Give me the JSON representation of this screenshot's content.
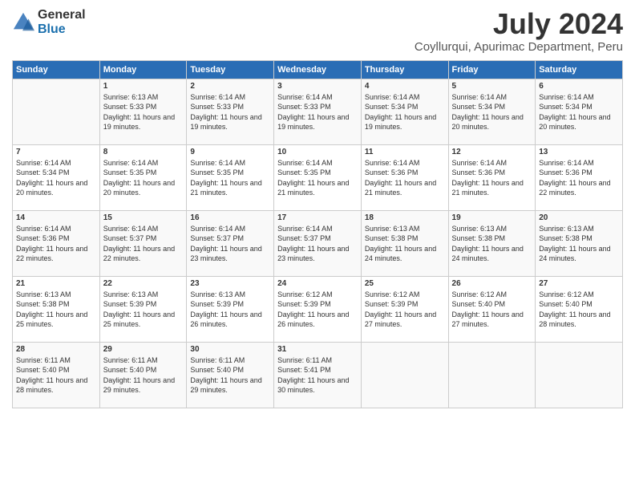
{
  "logo": {
    "general": "General",
    "blue": "Blue"
  },
  "header": {
    "month": "July 2024",
    "location": "Coyllurqui, Apurimac Department, Peru"
  },
  "days_of_week": [
    "Sunday",
    "Monday",
    "Tuesday",
    "Wednesday",
    "Thursday",
    "Friday",
    "Saturday"
  ],
  "weeks": [
    [
      {
        "day": "",
        "sunrise": "",
        "sunset": "",
        "daylight": ""
      },
      {
        "day": "1",
        "sunrise": "Sunrise: 6:13 AM",
        "sunset": "Sunset: 5:33 PM",
        "daylight": "Daylight: 11 hours and 19 minutes."
      },
      {
        "day": "2",
        "sunrise": "Sunrise: 6:14 AM",
        "sunset": "Sunset: 5:33 PM",
        "daylight": "Daylight: 11 hours and 19 minutes."
      },
      {
        "day": "3",
        "sunrise": "Sunrise: 6:14 AM",
        "sunset": "Sunset: 5:33 PM",
        "daylight": "Daylight: 11 hours and 19 minutes."
      },
      {
        "day": "4",
        "sunrise": "Sunrise: 6:14 AM",
        "sunset": "Sunset: 5:34 PM",
        "daylight": "Daylight: 11 hours and 19 minutes."
      },
      {
        "day": "5",
        "sunrise": "Sunrise: 6:14 AM",
        "sunset": "Sunset: 5:34 PM",
        "daylight": "Daylight: 11 hours and 20 minutes."
      },
      {
        "day": "6",
        "sunrise": "Sunrise: 6:14 AM",
        "sunset": "Sunset: 5:34 PM",
        "daylight": "Daylight: 11 hours and 20 minutes."
      }
    ],
    [
      {
        "day": "7",
        "sunrise": "Sunrise: 6:14 AM",
        "sunset": "Sunset: 5:34 PM",
        "daylight": "Daylight: 11 hours and 20 minutes."
      },
      {
        "day": "8",
        "sunrise": "Sunrise: 6:14 AM",
        "sunset": "Sunset: 5:35 PM",
        "daylight": "Daylight: 11 hours and 20 minutes."
      },
      {
        "day": "9",
        "sunrise": "Sunrise: 6:14 AM",
        "sunset": "Sunset: 5:35 PM",
        "daylight": "Daylight: 11 hours and 21 minutes."
      },
      {
        "day": "10",
        "sunrise": "Sunrise: 6:14 AM",
        "sunset": "Sunset: 5:35 PM",
        "daylight": "Daylight: 11 hours and 21 minutes."
      },
      {
        "day": "11",
        "sunrise": "Sunrise: 6:14 AM",
        "sunset": "Sunset: 5:36 PM",
        "daylight": "Daylight: 11 hours and 21 minutes."
      },
      {
        "day": "12",
        "sunrise": "Sunrise: 6:14 AM",
        "sunset": "Sunset: 5:36 PM",
        "daylight": "Daylight: 11 hours and 21 minutes."
      },
      {
        "day": "13",
        "sunrise": "Sunrise: 6:14 AM",
        "sunset": "Sunset: 5:36 PM",
        "daylight": "Daylight: 11 hours and 22 minutes."
      }
    ],
    [
      {
        "day": "14",
        "sunrise": "Sunrise: 6:14 AM",
        "sunset": "Sunset: 5:36 PM",
        "daylight": "Daylight: 11 hours and 22 minutes."
      },
      {
        "day": "15",
        "sunrise": "Sunrise: 6:14 AM",
        "sunset": "Sunset: 5:37 PM",
        "daylight": "Daylight: 11 hours and 22 minutes."
      },
      {
        "day": "16",
        "sunrise": "Sunrise: 6:14 AM",
        "sunset": "Sunset: 5:37 PM",
        "daylight": "Daylight: 11 hours and 23 minutes."
      },
      {
        "day": "17",
        "sunrise": "Sunrise: 6:14 AM",
        "sunset": "Sunset: 5:37 PM",
        "daylight": "Daylight: 11 hours and 23 minutes."
      },
      {
        "day": "18",
        "sunrise": "Sunrise: 6:13 AM",
        "sunset": "Sunset: 5:38 PM",
        "daylight": "Daylight: 11 hours and 24 minutes."
      },
      {
        "day": "19",
        "sunrise": "Sunrise: 6:13 AM",
        "sunset": "Sunset: 5:38 PM",
        "daylight": "Daylight: 11 hours and 24 minutes."
      },
      {
        "day": "20",
        "sunrise": "Sunrise: 6:13 AM",
        "sunset": "Sunset: 5:38 PM",
        "daylight": "Daylight: 11 hours and 24 minutes."
      }
    ],
    [
      {
        "day": "21",
        "sunrise": "Sunrise: 6:13 AM",
        "sunset": "Sunset: 5:38 PM",
        "daylight": "Daylight: 11 hours and 25 minutes."
      },
      {
        "day": "22",
        "sunrise": "Sunrise: 6:13 AM",
        "sunset": "Sunset: 5:39 PM",
        "daylight": "Daylight: 11 hours and 25 minutes."
      },
      {
        "day": "23",
        "sunrise": "Sunrise: 6:13 AM",
        "sunset": "Sunset: 5:39 PM",
        "daylight": "Daylight: 11 hours and 26 minutes."
      },
      {
        "day": "24",
        "sunrise": "Sunrise: 6:12 AM",
        "sunset": "Sunset: 5:39 PM",
        "daylight": "Daylight: 11 hours and 26 minutes."
      },
      {
        "day": "25",
        "sunrise": "Sunrise: 6:12 AM",
        "sunset": "Sunset: 5:39 PM",
        "daylight": "Daylight: 11 hours and 27 minutes."
      },
      {
        "day": "26",
        "sunrise": "Sunrise: 6:12 AM",
        "sunset": "Sunset: 5:40 PM",
        "daylight": "Daylight: 11 hours and 27 minutes."
      },
      {
        "day": "27",
        "sunrise": "Sunrise: 6:12 AM",
        "sunset": "Sunset: 5:40 PM",
        "daylight": "Daylight: 11 hours and 28 minutes."
      }
    ],
    [
      {
        "day": "28",
        "sunrise": "Sunrise: 6:11 AM",
        "sunset": "Sunset: 5:40 PM",
        "daylight": "Daylight: 11 hours and 28 minutes."
      },
      {
        "day": "29",
        "sunrise": "Sunrise: 6:11 AM",
        "sunset": "Sunset: 5:40 PM",
        "daylight": "Daylight: 11 hours and 29 minutes."
      },
      {
        "day": "30",
        "sunrise": "Sunrise: 6:11 AM",
        "sunset": "Sunset: 5:40 PM",
        "daylight": "Daylight: 11 hours and 29 minutes."
      },
      {
        "day": "31",
        "sunrise": "Sunrise: 6:11 AM",
        "sunset": "Sunset: 5:41 PM",
        "daylight": "Daylight: 11 hours and 30 minutes."
      },
      {
        "day": "",
        "sunrise": "",
        "sunset": "",
        "daylight": ""
      },
      {
        "day": "",
        "sunrise": "",
        "sunset": "",
        "daylight": ""
      },
      {
        "day": "",
        "sunrise": "",
        "sunset": "",
        "daylight": ""
      }
    ]
  ]
}
